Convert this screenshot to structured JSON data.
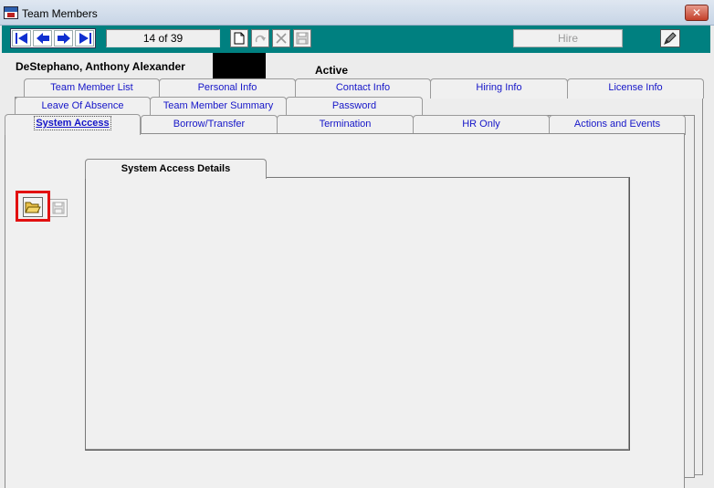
{
  "window": {
    "title": "Team Members",
    "close_glyph": "✕"
  },
  "toolbar": {
    "nav_buttons": [
      {
        "name": "first-record-button",
        "glyph": "⏮"
      },
      {
        "name": "previous-record-button",
        "glyph": "◀"
      },
      {
        "name": "next-record-button",
        "glyph": "▶"
      },
      {
        "name": "last-record-button",
        "glyph": "⏭"
      }
    ],
    "record_position": "14 of 39",
    "hire_label": "Hire",
    "icons": {
      "new": "new-document-icon",
      "redo": "redo-icon",
      "delete": "delete-x-icon",
      "save": "save-disk-icon",
      "edit": "pencil-edit-icon"
    }
  },
  "member": {
    "name": "DeStephano, Anthony Alexander",
    "status": "Active"
  },
  "tabs": {
    "row1": [
      "Team Member List",
      "Personal Info",
      "Contact Info",
      "Hiring Info",
      "License Info"
    ],
    "row2": [
      "Leave Of Absence",
      "Team Member Summary",
      "Password"
    ],
    "row3": [
      "System Access",
      "Borrow/Transfer",
      "Termination",
      "HR Only",
      "Actions and Events"
    ],
    "active": "System Access"
  },
  "system_access": {
    "details_tab_label": "System Access Details",
    "open_icon": "open-folder-icon",
    "save_icon": "save-disk-icon"
  },
  "colors": {
    "toolbar": "#008080",
    "tab_text": "#1515c8",
    "highlight": "#e21010"
  }
}
